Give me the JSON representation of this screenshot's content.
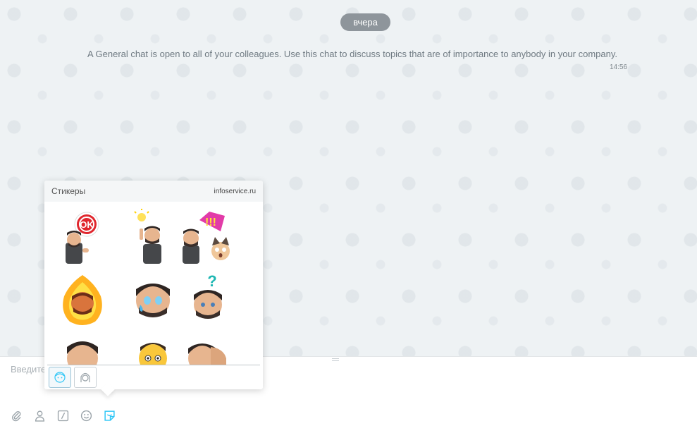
{
  "chat": {
    "date_label": "вчера",
    "system_message": "A General chat is open to all of your colleagues. Use this chat to discuss topics that are of importance to anybody in your company.",
    "system_time": "14:56"
  },
  "sticker_popup": {
    "title": "Стикеры",
    "source": "infoservice.ru",
    "stickers": [
      {
        "name": "ok-sticker"
      },
      {
        "name": "idea-sticker"
      },
      {
        "name": "cat-surprise-sticker"
      },
      {
        "name": "fire-angry-sticker"
      },
      {
        "name": "crying-sticker"
      },
      {
        "name": "confused-sticker"
      },
      {
        "name": "man-sticker-7"
      },
      {
        "name": "yellow-face-sticker"
      },
      {
        "name": "facepalm-sticker"
      }
    ],
    "packs": [
      {
        "name": "bitmoji-pack",
        "active": true
      },
      {
        "name": "girl-pack",
        "active": false
      }
    ]
  },
  "composer": {
    "placeholder": "Введите сообщение"
  },
  "toolbar": {
    "icons": [
      "paperclip-icon",
      "person-icon",
      "command-icon",
      "smile-icon",
      "sticker-icon"
    ],
    "active_icon": "sticker-icon",
    "accent_color": "#2fc6f6"
  }
}
